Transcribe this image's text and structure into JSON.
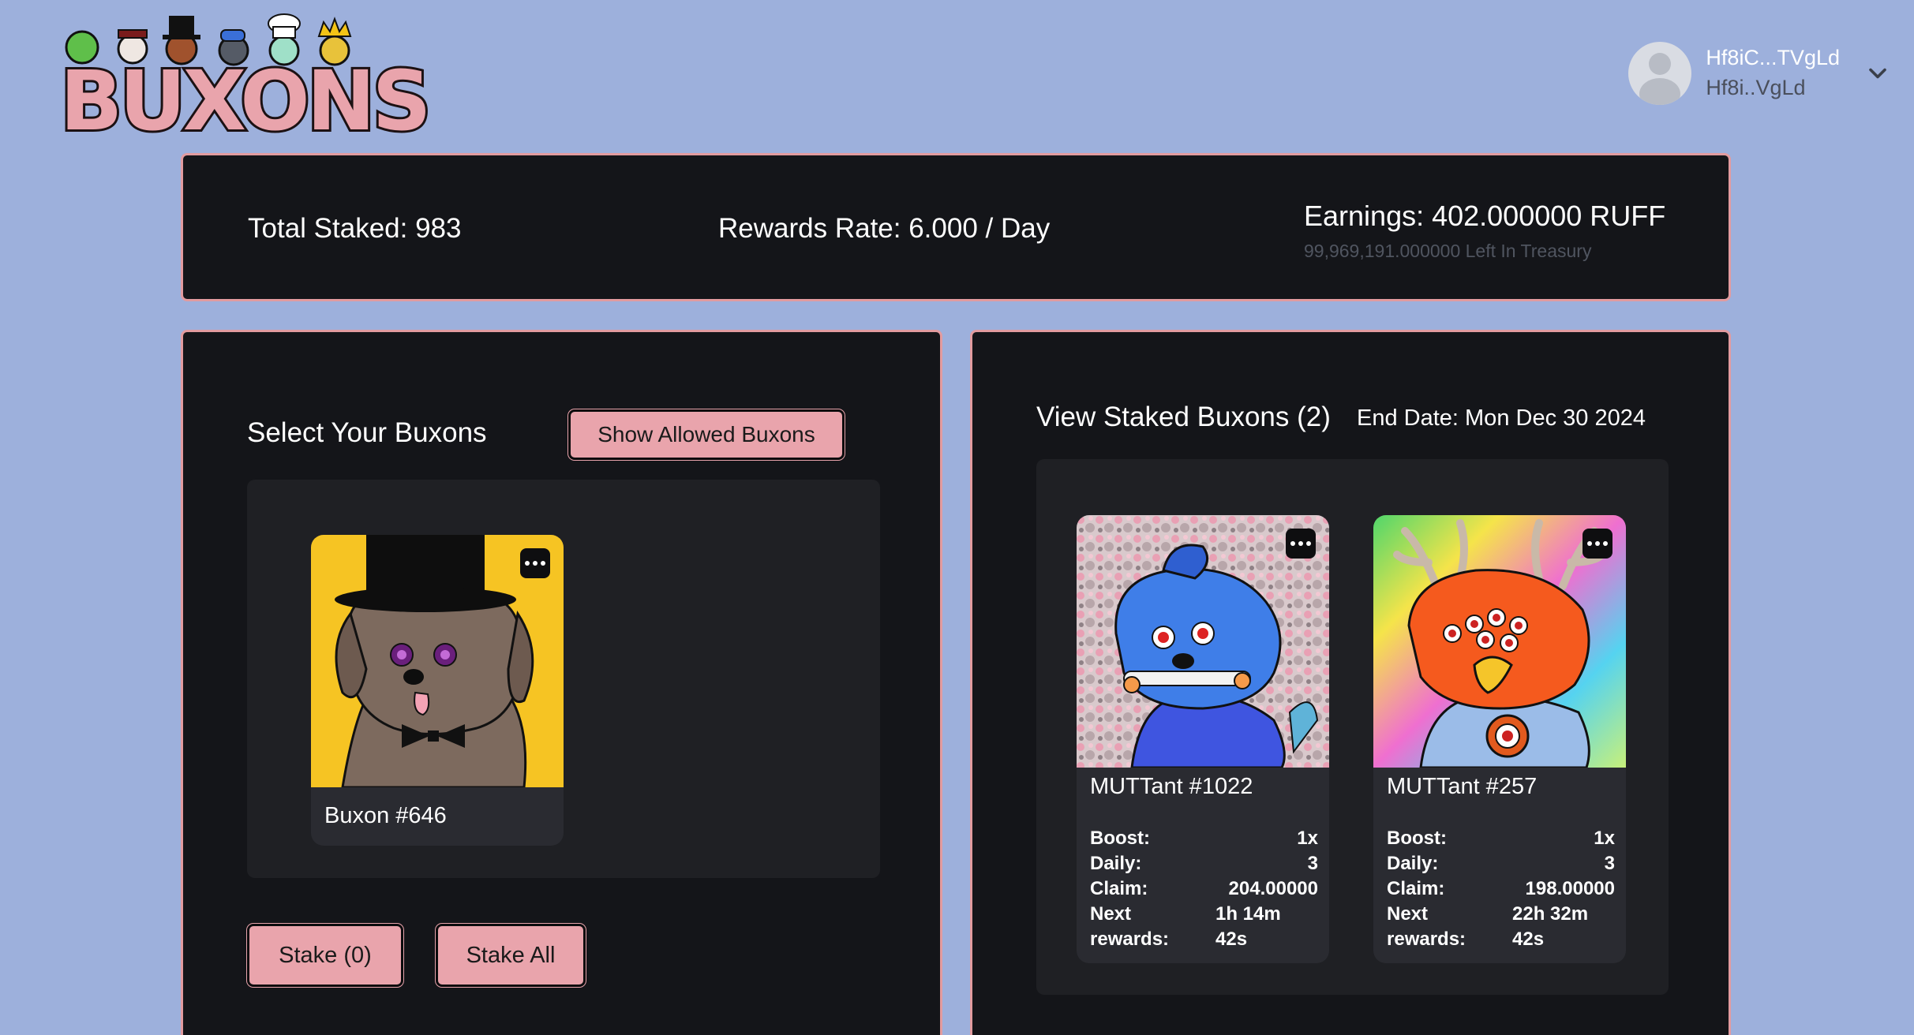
{
  "header": {
    "logo_text": "BUXONS",
    "wallet": {
      "name": "Hf8iC...TVgLd",
      "short": "Hf8i..VgLd"
    }
  },
  "stats": {
    "total_staked": "Total Staked: 983",
    "rewards_rate": "Rewards Rate: 6.000 / Day",
    "earnings": "Earnings: 402.000000 RUFF",
    "treasury": "99,969,191.000000 Left In Treasury"
  },
  "select": {
    "title": "Select Your Buxons",
    "show_allowed_label": "Show Allowed Buxons",
    "cards": [
      {
        "name": "Buxon #646"
      }
    ],
    "stake_label": "Stake (0)",
    "stake_all_label": "Stake All"
  },
  "staked": {
    "title": "View Staked Buxons (2)",
    "end_date": "End Date: Mon Dec 30 2024",
    "labels": {
      "boost": "Boost:",
      "daily": "Daily:",
      "claim": "Claim:",
      "next": "Next",
      "rewards": "rewards:"
    },
    "cards": [
      {
        "name": "MUTTant #1022",
        "boost": "1x",
        "daily": "3",
        "claim": "204.00000",
        "next": "1h 14m",
        "rewards": "42s"
      },
      {
        "name": "MUTTant #257",
        "boost": "1x",
        "daily": "3",
        "claim": "198.00000",
        "next": "22h 32m",
        "rewards": "42s"
      }
    ]
  },
  "colors": {
    "page_bg": "#9db0dc",
    "panel_bg": "#141519",
    "accent_pink": "#e9a4ac",
    "panel_border": "#e29b9f"
  },
  "icons": {
    "wallet_avatar": "user-avatar-icon",
    "wallet_menu": "chevron-down-icon",
    "card_menu": "more-options-icon"
  }
}
